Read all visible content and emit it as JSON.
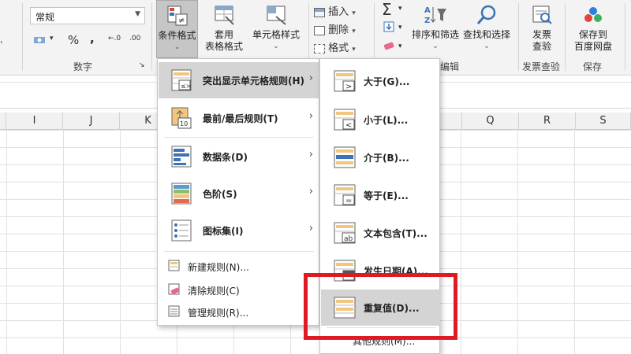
{
  "ribbon": {
    "number_format": "常规",
    "number_buttons": [
      "%",
      ",",
      "←.0",
      ".00"
    ],
    "number_group_label": "数字",
    "conditional_format_label": "条件格式",
    "table_format_label_1": "套用",
    "table_format_label_2": "表格格式",
    "cell_styles_label": "单元格样式",
    "insert_label": "插入",
    "delete_label": "删除",
    "format_label": "格式",
    "sort_filter_label": "排序和筛选",
    "find_select_label": "查找和选择",
    "editing_group_label": "编辑",
    "invoice_check_label_1": "发票",
    "invoice_check_label_2": "查验",
    "invoice_group_label": "发票查验",
    "save_baidu_label_1": "保存到",
    "save_baidu_label_2": "百度网盘",
    "save_group_label": "保存"
  },
  "sheet": {
    "columns": [
      "I",
      "J",
      "K",
      "Q",
      "R",
      "S"
    ]
  },
  "cf_menu": {
    "items": [
      {
        "label": "突出显示单元格规则(H)",
        "icon": "highlight-rules-icon"
      },
      {
        "label": "最前/最后规则(T)",
        "icon": "top-bottom-rules-icon"
      },
      {
        "label": "数据条(D)",
        "icon": "data-bars-icon"
      },
      {
        "label": "色阶(S)",
        "icon": "color-scales-icon"
      },
      {
        "label": "图标集(I)",
        "icon": "icon-sets-icon"
      }
    ],
    "actions": [
      {
        "label": "新建规则(N)...",
        "icon": "new-rule-icon"
      },
      {
        "label": "清除规则(C)",
        "icon": "clear-rules-icon"
      },
      {
        "label": "管理规则(R)...",
        "icon": "manage-rules-icon"
      }
    ]
  },
  "sub_menu": {
    "items": [
      {
        "label": "大于(G)...",
        "icon": "greater-than-icon"
      },
      {
        "label": "小于(L)...",
        "icon": "less-than-icon"
      },
      {
        "label": "介于(B)...",
        "icon": "between-icon"
      },
      {
        "label": "等于(E)...",
        "icon": "equal-to-icon"
      },
      {
        "label": "文本包含(T)...",
        "icon": "text-contains-icon"
      },
      {
        "label": "发生日期(A)...",
        "icon": "date-occurring-icon"
      },
      {
        "label": "重复值(D)...",
        "icon": "duplicate-values-icon"
      }
    ],
    "more_label": "其他规则(M)..."
  },
  "colors": {
    "highlight_box": "#e01a22",
    "menu_hover": "#d4d4d4"
  }
}
